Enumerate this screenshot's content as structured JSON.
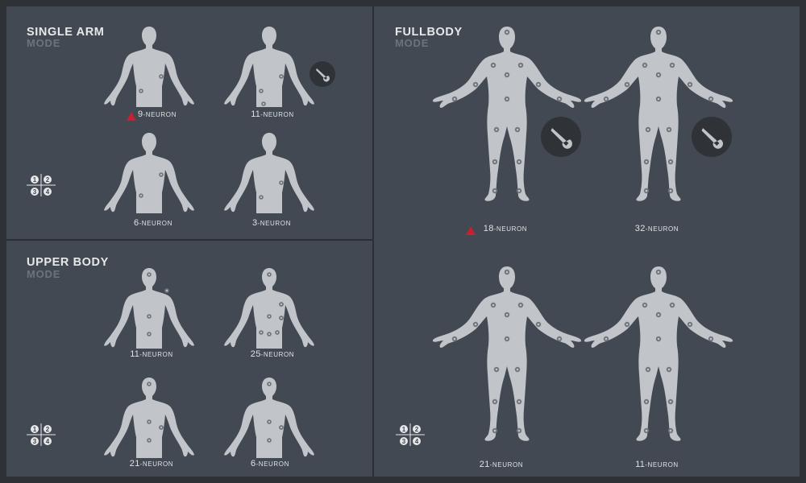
{
  "panels": {
    "single_arm": {
      "title": "SINGLE ARM",
      "subtitle": "MODE",
      "figures": [
        {
          "count": "9",
          "unit": "-NEURON",
          "warning": true,
          "wrench": false
        },
        {
          "count": "11",
          "unit": "-NEURON",
          "warning": false,
          "wrench": true
        },
        {
          "count": "6",
          "unit": "-NEURON",
          "warning": false,
          "wrench": false
        },
        {
          "count": "3",
          "unit": "-NEURON",
          "warning": false,
          "wrench": false
        }
      ],
      "grid_labels": [
        "1",
        "2",
        "3",
        "4"
      ]
    },
    "upper_body": {
      "title": "UPPER BODY",
      "subtitle": "MODE",
      "figures": [
        {
          "count": "11",
          "unit": "-NEURON"
        },
        {
          "count": "25",
          "unit": "-NEURON"
        },
        {
          "count": "21",
          "unit": "-NEURON"
        },
        {
          "count": "6",
          "unit": "-NEURON"
        }
      ],
      "grid_labels": [
        "1",
        "2",
        "3",
        "4"
      ]
    },
    "fullbody": {
      "title": "FULLBODY",
      "subtitle": "MODE",
      "figures": [
        {
          "count": "18",
          "unit": "-NEURON",
          "warning": true,
          "wrench": true
        },
        {
          "count": "32",
          "unit": "-NEURON",
          "warning": false,
          "wrench": true
        },
        {
          "count": "21",
          "unit": "-NEURON",
          "warning": false,
          "wrench": false
        },
        {
          "count": "11",
          "unit": "-NEURON",
          "warning": false,
          "wrench": false
        }
      ],
      "grid_labels": [
        "1",
        "2",
        "3",
        "4"
      ]
    }
  },
  "colors": {
    "background": "#434952",
    "body": "#c1c4c8",
    "sensor": "#6f757d",
    "warning": "#c8202f",
    "wrench_bg": "#2f3338"
  },
  "icons": {
    "warning": "warning-triangle-icon",
    "wrench": "wrench-icon",
    "grid": "quadrant-grid-icon"
  }
}
